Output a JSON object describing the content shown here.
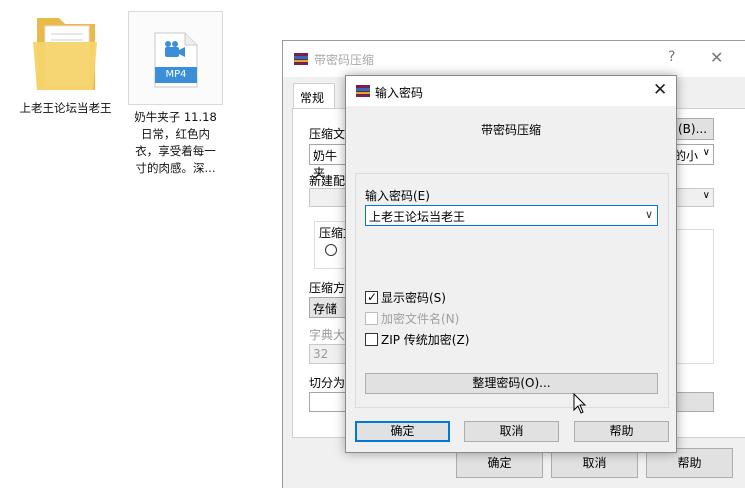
{
  "desktop": {
    "folder": {
      "label": "上老王论坛当老王",
      "icon": "folder-icon"
    },
    "video": {
      "badge": "MP4",
      "label": "奶牛夹子 11.18 日常，红色内衣，享受着每一寸的肉感。深...",
      "icon": "video-file-icon"
    }
  },
  "back_dialog": {
    "title": "带密码压缩",
    "help": "?",
    "close": "✕",
    "tab": "常规",
    "fields": {
      "archive_name_label": "压缩文",
      "archive_name_value": "奶牛夹",
      "browse_button": "(B)...",
      "profile_label": "新建配",
      "size_suffix": "的小",
      "format_group": "压缩文",
      "method_label": "压缩方",
      "method_value": "存储",
      "dict_label": "字典大",
      "dict_value": "32",
      "split_label": "切分为"
    },
    "buttons": {
      "ok": "确定",
      "cancel": "取消",
      "help": "帮助"
    }
  },
  "front_dialog": {
    "title": "输入密码",
    "close": "✕",
    "heading": "带密码压缩",
    "password_label": "输入密码(E)",
    "password_value": "上老王论坛当老王",
    "checkboxes": {
      "show_password": {
        "label": "显示密码(S)",
        "checked": true,
        "enabled": true
      },
      "encrypt_names": {
        "label": "加密文件名(N)",
        "checked": false,
        "enabled": false
      },
      "zip_legacy": {
        "label": "ZIP 传统加密(Z)",
        "checked": false,
        "enabled": true
      }
    },
    "organize_button": "整理密码(O)...",
    "buttons": {
      "ok": "确定",
      "cancel": "取消",
      "help": "帮助"
    }
  },
  "colors": {
    "accent": "#0078d7",
    "dialog_bg": "#f0f0f0",
    "button_bg": "#e1e1e1",
    "folder": "#f6d46b",
    "mp4_badge": "#3b8fd9"
  }
}
